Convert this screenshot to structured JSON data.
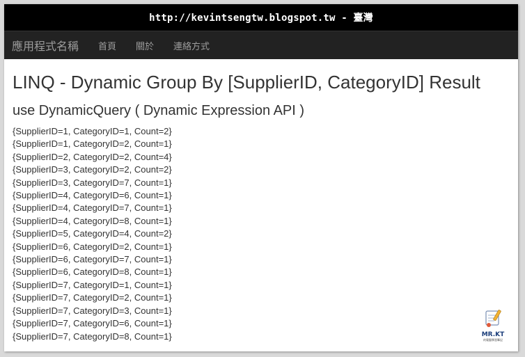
{
  "url_bar": {
    "text": "http://kevintsengtw.blogspot.tw - 臺灣"
  },
  "navbar": {
    "brand": "應用程式名稱",
    "links": [
      "首頁",
      "關於",
      "連絡方式"
    ]
  },
  "main": {
    "title": "LINQ - Dynamic Group By [SupplierID, CategoryID] Result",
    "subtitle": "use DynamicQuery ( Dynamic Expression API )",
    "results": [
      "{SupplierID=1, CategoryID=1, Count=2}",
      "{SupplierID=1, CategoryID=2, Count=1}",
      "{SupplierID=2, CategoryID=2, Count=4}",
      "{SupplierID=3, CategoryID=2, Count=2}",
      "{SupplierID=3, CategoryID=7, Count=1}",
      "{SupplierID=4, CategoryID=6, Count=1}",
      "{SupplierID=4, CategoryID=7, Count=1}",
      "{SupplierID=4, CategoryID=8, Count=1}",
      "{SupplierID=5, CategoryID=4, Count=2}",
      "{SupplierID=6, CategoryID=2, Count=1}",
      "{SupplierID=6, CategoryID=7, Count=1}",
      "{SupplierID=6, CategoryID=8, Count=1}",
      "{SupplierID=7, CategoryID=1, Count=1}",
      "{SupplierID=7, CategoryID=2, Count=1}",
      "{SupplierID=7, CategoryID=3, Count=1}",
      "{SupplierID=7, CategoryID=6, Count=1}",
      "{SupplierID=7, CategoryID=8, Count=1}"
    ]
  },
  "watermark": {
    "text": "MR.KT",
    "subtext": "的電腦學習筆記"
  }
}
